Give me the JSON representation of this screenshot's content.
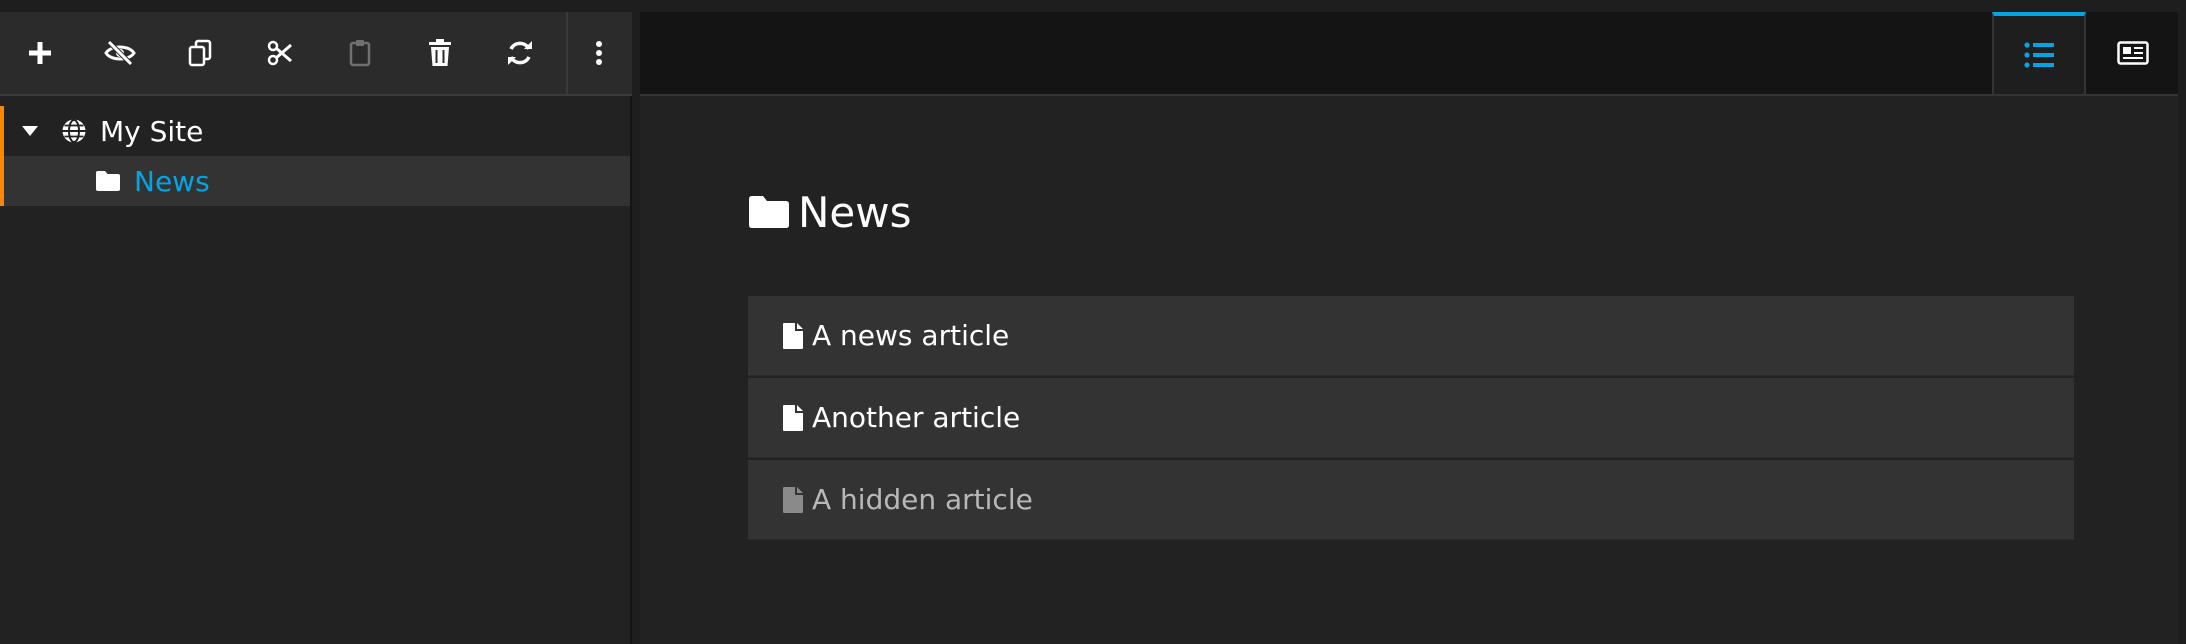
{
  "toolbar": {
    "buttons": [
      {
        "name": "add",
        "icon": "plus-icon",
        "enabled": true
      },
      {
        "name": "hide",
        "icon": "eye-slash-icon",
        "enabled": true
      },
      {
        "name": "copy",
        "icon": "copy-icon",
        "enabled": true
      },
      {
        "name": "cut",
        "icon": "scissors-icon",
        "enabled": true
      },
      {
        "name": "paste",
        "icon": "clipboard-icon",
        "enabled": false
      },
      {
        "name": "delete",
        "icon": "trash-icon",
        "enabled": true
      },
      {
        "name": "refresh",
        "icon": "refresh-icon",
        "enabled": true
      },
      {
        "name": "more",
        "icon": "ellipsis-vertical-icon",
        "enabled": true
      }
    ]
  },
  "tree": {
    "root": {
      "label": "My Site",
      "icon": "globe-icon",
      "expanded": true
    },
    "children": [
      {
        "label": "News",
        "icon": "folder-icon",
        "selected": true
      }
    ]
  },
  "view_switcher": {
    "active": "list",
    "options": [
      {
        "name": "list",
        "icon": "list-icon"
      },
      {
        "name": "preview",
        "icon": "newspaper-icon"
      }
    ]
  },
  "main": {
    "title": "News",
    "title_icon": "folder-icon",
    "items": [
      {
        "label": "A news article",
        "icon": "document-icon",
        "hidden": false
      },
      {
        "label": "Another article",
        "icon": "document-icon",
        "hidden": false
      },
      {
        "label": "A hidden article",
        "icon": "document-icon",
        "hidden": true
      }
    ]
  },
  "colors": {
    "accent_blue": "#00a5e6",
    "accent_orange": "#ff8700",
    "panel_bg": "#222222",
    "toolbar_bg": "#2b2b2b",
    "item_bg": "#333333"
  }
}
